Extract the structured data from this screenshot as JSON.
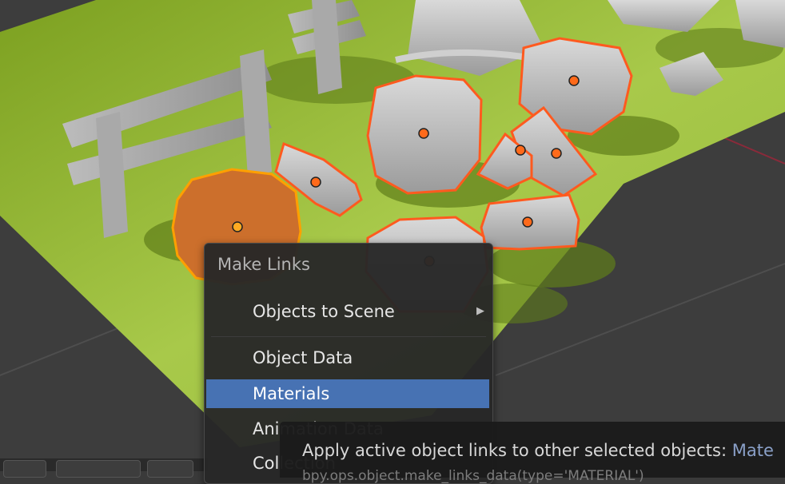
{
  "menu": {
    "title": "Make Links",
    "items": [
      {
        "label": "Objects to Scene",
        "has_submenu": true,
        "submenu_arrow": "▶"
      },
      {
        "label": "Object Data"
      },
      {
        "label": "Materials",
        "active": true
      },
      {
        "label": "Animation Data"
      },
      {
        "label": "Collection"
      }
    ]
  },
  "tooltip": {
    "text": "Apply active object links to other selected objects:",
    "python": "Mate",
    "next_line": "bpy.ops.object.make_links_data(type='MATERIAL')"
  },
  "colors": {
    "accent": "#4772b3",
    "selected_outline": "#ff5a1f",
    "active_outline": "#ffa000",
    "grass": "#9dc53a"
  }
}
